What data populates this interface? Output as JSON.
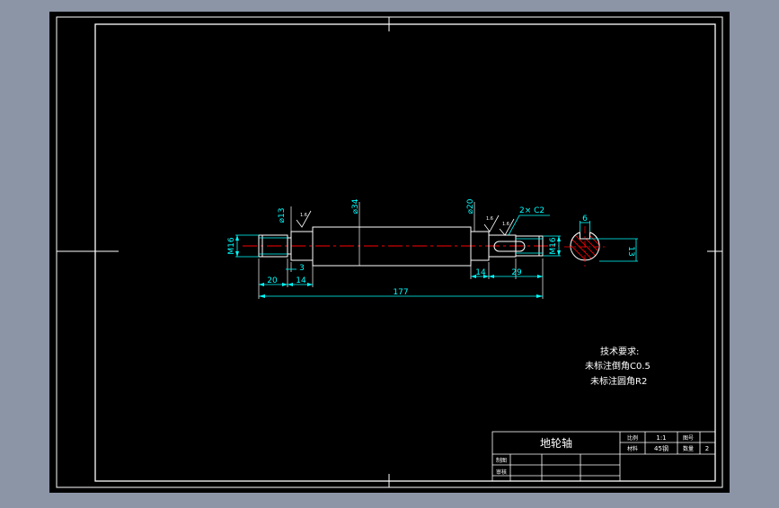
{
  "colors": {
    "background": "#8c95a6",
    "sheet": "#000000",
    "frame": "#ffffff",
    "part": "#ffffff",
    "dimension": "#00ffff",
    "centerline": "#ff0000",
    "hatch": "#ff0000",
    "symbol": "#ffffff"
  },
  "drawing": {
    "diameters": {
      "d13": "⌀13",
      "d34": "⌀34",
      "d20": "⌀20"
    },
    "threads": {
      "left": "M16",
      "right": "M16"
    },
    "chamfer_note": "2× C2",
    "lengths": {
      "l3": "3",
      "l20": "20",
      "l14a": "14",
      "l14b": "14",
      "l29": "29",
      "total": "177"
    },
    "section": {
      "key_width": "6",
      "depth": "13"
    },
    "roughness_value": "1.6"
  },
  "notes": {
    "heading": "技术要求:",
    "line1": "未标注倒角C0.5",
    "line2": "未标注圆角R2"
  },
  "title_block": {
    "part_name": "地轮轴",
    "scale_label": "比例",
    "scale_value": "1:1",
    "drawing_no_label": "图号",
    "material_label": "材料",
    "material_value": "45钢",
    "quantity_label": "数量",
    "quantity_value": "2",
    "drawn_label": "制图",
    "checked_label": "审核"
  }
}
